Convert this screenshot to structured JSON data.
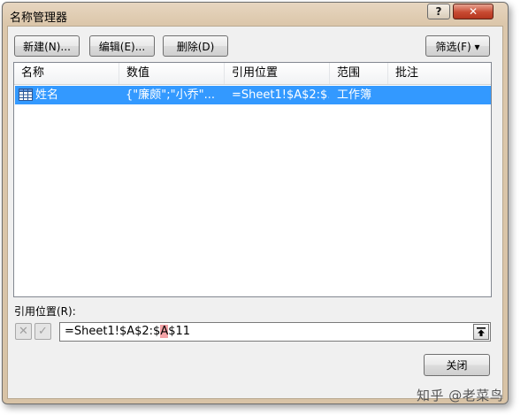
{
  "window": {
    "title": "名称管理器",
    "help_label": "?",
    "close_glyph": "✕"
  },
  "toolbar": {
    "new_label": "新建(N)...",
    "edit_label": "编辑(E)...",
    "delete_label": "删除(D)",
    "filter_label": "筛选(F) ▾"
  },
  "list": {
    "columns": [
      "名称",
      "数值",
      "引用位置",
      "范围",
      "批注"
    ],
    "rows": [
      {
        "name": "姓名",
        "value": "{\"廉颇\";\"小乔\"...",
        "refers_to": "=Sheet1!$A$2:$...",
        "scope": "工作簿",
        "comment": ""
      }
    ]
  },
  "refers_to": {
    "label": "引用位置(R):",
    "value_before": "=Sheet1!$A$2:$",
    "value_highlight": "A",
    "value_after": "$11",
    "cancel_glyph": "✕",
    "confirm_glyph": "✓"
  },
  "footer": {
    "close_label": "关闭"
  },
  "watermark": "知乎 @老菜鸟",
  "colors": {
    "selection": "#3399ff",
    "title_bar": "#dcc7ab",
    "close_button": "#c84a32",
    "highlight": "#f4a2a6"
  }
}
